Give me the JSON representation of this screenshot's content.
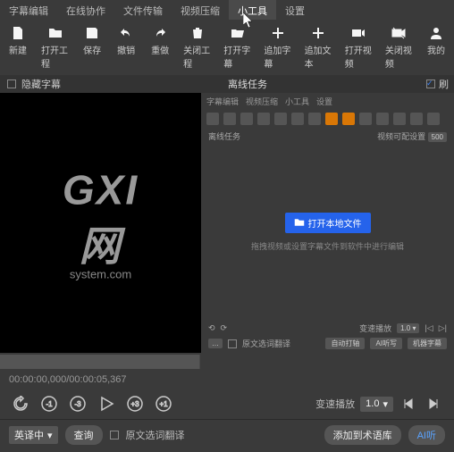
{
  "tabs": [
    "字幕编辑",
    "在线协作",
    "文件传输",
    "视频压缩",
    "小工具",
    "设置"
  ],
  "active_tab_index": 4,
  "toolbar": [
    {
      "label": "新建",
      "icon": "file"
    },
    {
      "label": "打开工程",
      "icon": "folder"
    },
    {
      "label": "保存",
      "icon": "save"
    },
    {
      "label": "撤销",
      "icon": "undo"
    },
    {
      "label": "重做",
      "icon": "redo"
    },
    {
      "label": "关闭工程",
      "icon": "trash"
    },
    {
      "label": "打开字幕",
      "icon": "folder-open"
    },
    {
      "label": "追加字幕",
      "icon": "plus"
    },
    {
      "label": "追加文本",
      "icon": "plus"
    },
    {
      "label": "打开视频",
      "icon": "video"
    },
    {
      "label": "关闭视频",
      "icon": "video-off"
    },
    {
      "label": "我的",
      "icon": "user"
    }
  ],
  "subheader": {
    "hide_label": "隐藏字幕",
    "offline_label": "离线任务",
    "right_check_label": "刷"
  },
  "watermark": {
    "big": "GXI网",
    "small": "system.com"
  },
  "side_panel": {
    "mini_tabs": [
      "字幕编辑",
      "视频压缩",
      "小工具",
      "设置"
    ],
    "task_label": "离线任务",
    "param_label": "视频可配设置",
    "param_value": "500",
    "open_button": "打开本地文件",
    "hint_text": "拖拽视频或设置字幕文件到软件中进行编辑",
    "speed_label": "变速播放",
    "speed_value": "1.0",
    "translate_label": "原文选词翻译",
    "auto_label": "自动打轴",
    "ai_label": "AI听写",
    "kj_label": "机器字幕"
  },
  "timecode": "00:00:00,000/00:00:05,367",
  "playback": {
    "speed_label": "变速播放",
    "speed_value": "1.0"
  },
  "bottom": {
    "lang_value": "英译中",
    "query_btn": "查询",
    "translate_label": "原文选词翻译",
    "add_term_btn": "添加到术语库",
    "ai_btn": "AI听"
  }
}
